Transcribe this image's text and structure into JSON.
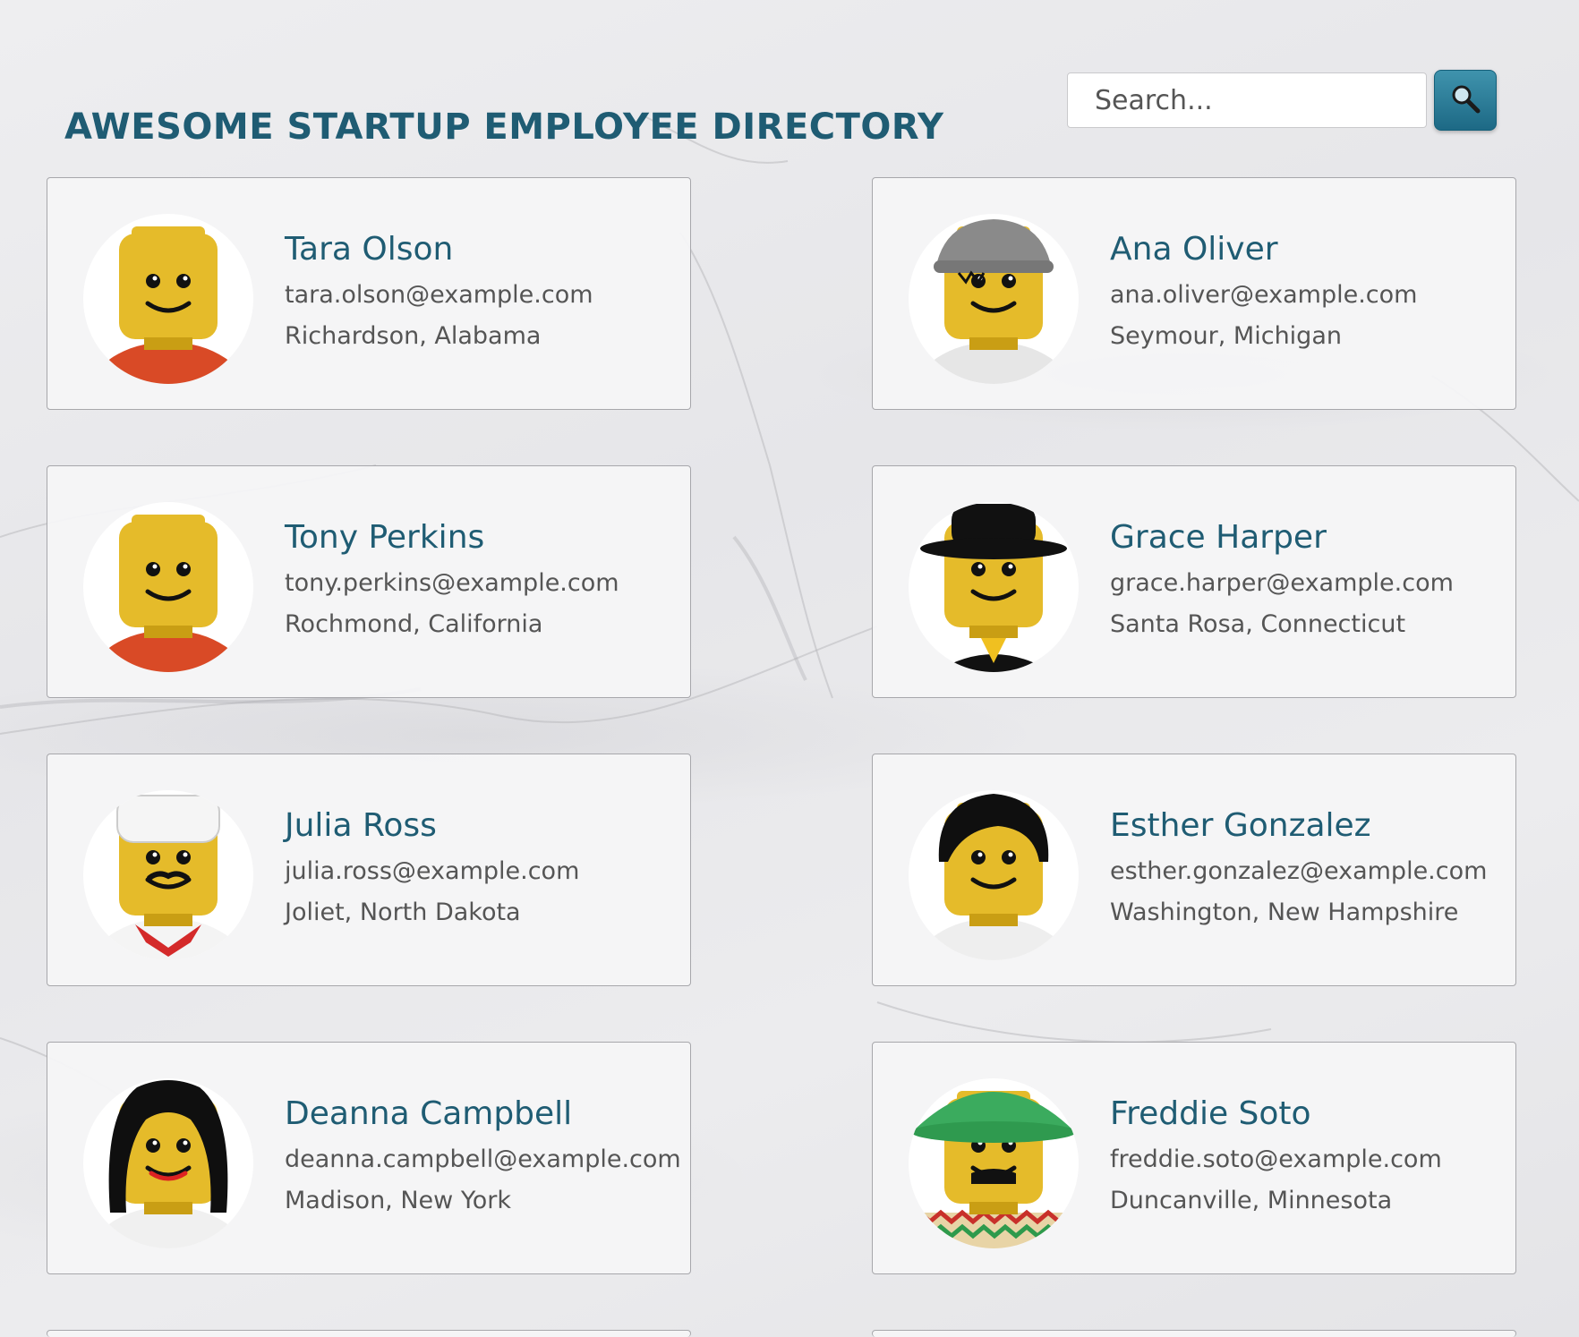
{
  "header": {
    "title": "AWESOME STARTUP EMPLOYEE DIRECTORY"
  },
  "search": {
    "placeholder": "Search...",
    "value": "",
    "button_icon": "search-icon"
  },
  "colors": {
    "accent": "#1f5c73",
    "button": "#2a7c98",
    "card_border": "#a7a7ab"
  },
  "employees": [
    {
      "name": "Tara Olson",
      "email": "tara.olson@example.com",
      "location": "Richardson, Alabama",
      "avatar": "lego-minifig-plain-red"
    },
    {
      "name": "Ana Oliver",
      "email": "ana.oliver@example.com",
      "location": "Seymour, Michigan",
      "avatar": "lego-minifig-grey-cap"
    },
    {
      "name": "Tony Perkins",
      "email": "tony.perkins@example.com",
      "location": "Rochmond, California",
      "avatar": "lego-minifig-plain-red"
    },
    {
      "name": "Grace Harper",
      "email": "grace.harper@example.com",
      "location": "Santa Rosa, Connecticut",
      "avatar": "lego-minifig-black-hat"
    },
    {
      "name": "Julia Ross",
      "email": "julia.ross@example.com",
      "location": "Joliet, North Dakota",
      "avatar": "lego-minifig-chef"
    },
    {
      "name": "Esther Gonzalez",
      "email": "esther.gonzalez@example.com",
      "location": "Washington, New Hampshire",
      "avatar": "lego-minifig-black-hair"
    },
    {
      "name": "Deanna Campbell",
      "email": "deanna.campbell@example.com",
      "location": "Madison, New York",
      "avatar": "lego-minifig-long-hair"
    },
    {
      "name": "Freddie Soto",
      "email": "freddie.soto@example.com",
      "location": "Duncanville, Minnesota",
      "avatar": "lego-minifig-sombrero"
    }
  ]
}
